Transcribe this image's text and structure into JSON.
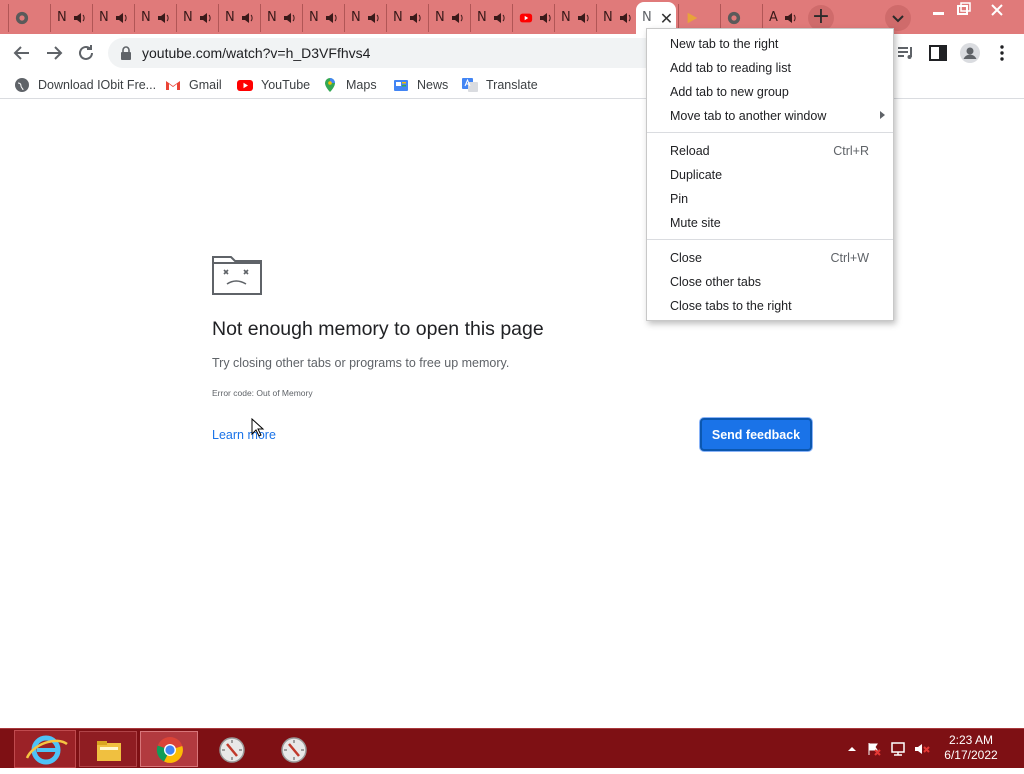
{
  "browser": {
    "active_tab_label": "N",
    "inactive_tab_letter": "N",
    "tab_A_letter": "A",
    "new_tab_symbol": "+",
    "close_symbol": "✕",
    "url": "youtube.com/watch?v=h_D3VFfhvs4"
  },
  "bookmarks": [
    {
      "label": "Download IObit Fre...",
      "icon": "globe-icon"
    },
    {
      "label": "Gmail",
      "icon": "gmail-icon"
    },
    {
      "label": "YouTube",
      "icon": "youtube-icon"
    },
    {
      "label": "Maps",
      "icon": "maps-icon"
    },
    {
      "label": "News",
      "icon": "news-icon"
    },
    {
      "label": "Translate",
      "icon": "translate-icon"
    }
  ],
  "error_page": {
    "title": "Not enough memory to open this page",
    "subtitle": "Try closing other tabs or programs to free up memory.",
    "error_code": "Error code: Out of Memory",
    "learn_more": "Learn more",
    "feedback_button": "Send feedback"
  },
  "context_menu": {
    "items": [
      {
        "label": "New tab to the right",
        "shortcut": ""
      },
      {
        "label": "Add tab to reading list",
        "shortcut": ""
      },
      {
        "label": "Add tab to new group",
        "shortcut": ""
      },
      {
        "label": "Move tab to another window",
        "shortcut": ""
      },
      {
        "label": "Reload",
        "shortcut": "Ctrl+R"
      },
      {
        "label": "Duplicate",
        "shortcut": ""
      },
      {
        "label": "Pin",
        "shortcut": ""
      },
      {
        "label": "Mute site",
        "shortcut": ""
      },
      {
        "label": "Close",
        "shortcut": "Ctrl+W"
      },
      {
        "label": "Close other tabs",
        "shortcut": ""
      },
      {
        "label": "Close tabs to the right",
        "shortcut": ""
      }
    ]
  },
  "taskbar": {
    "time": "2:23 AM",
    "date": "6/17/2022",
    "apps": [
      "internet-explorer-icon",
      "file-explorer-icon",
      "chrome-icon",
      "compass-icon",
      "compass-icon"
    ]
  },
  "colors": {
    "tabstrip": "#e07a7a",
    "taskbar": "#7e1014",
    "accent": "#1a73e8"
  }
}
